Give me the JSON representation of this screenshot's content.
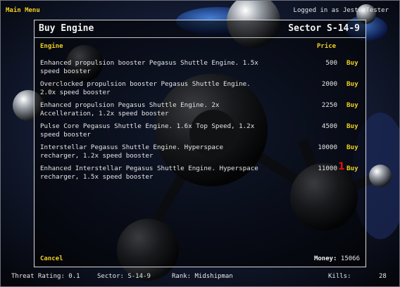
{
  "top": {
    "main_menu": "Main Menu",
    "login_text": "Logged in as JesterTester"
  },
  "panel": {
    "title": "Buy Engine",
    "sector": "Sector S-14-9",
    "col_engine": "Engine",
    "col_price": "Price",
    "buy_label": "Buy",
    "rows": [
      {
        "desc_1": "Enhanced propulsion booster Pegasus Shuttle Engine. 1.5x",
        "desc_2": "speed booster",
        "price": "500"
      },
      {
        "desc_1": "Overclocked propulsion booster Pegasus Shuttle Engine.",
        "desc_2": "2.0x speed booster",
        "price": "2000"
      },
      {
        "desc_1": "Enhanced propulsion Pegasus Shuttle Engine. 2x",
        "desc_2": "Accelleration, 1.2x speed booster",
        "price": "2250"
      },
      {
        "desc_1": "Pulse Core Pegasus Shuttle Engine. 1.6x Top Speed, 1.2x",
        "desc_2": "speed booster",
        "price": "4500"
      },
      {
        "desc_1": "Interstellar Pegasus Shuttle Engine. Hyperspace",
        "desc_2": "recharger, 1.2x speed booster",
        "price": "10000"
      },
      {
        "desc_1": "Enhanced Interstellar Pegasus Shuttle Engine. Hyperspace",
        "desc_2": "recharger, 1.5x speed booster",
        "price": "11000"
      }
    ],
    "marker": "1",
    "cancel": "Cancel",
    "money_label": "Money:",
    "money_value": "15066"
  },
  "status": {
    "threat": "Threat Rating: 0.1",
    "sector": "Sector: S-14-9",
    "rank": "Rank: Midshipman",
    "kills_label": "Kills:",
    "kills_value": "28"
  },
  "colors": {
    "accent": "#f0d020",
    "marker": "#e01010"
  }
}
